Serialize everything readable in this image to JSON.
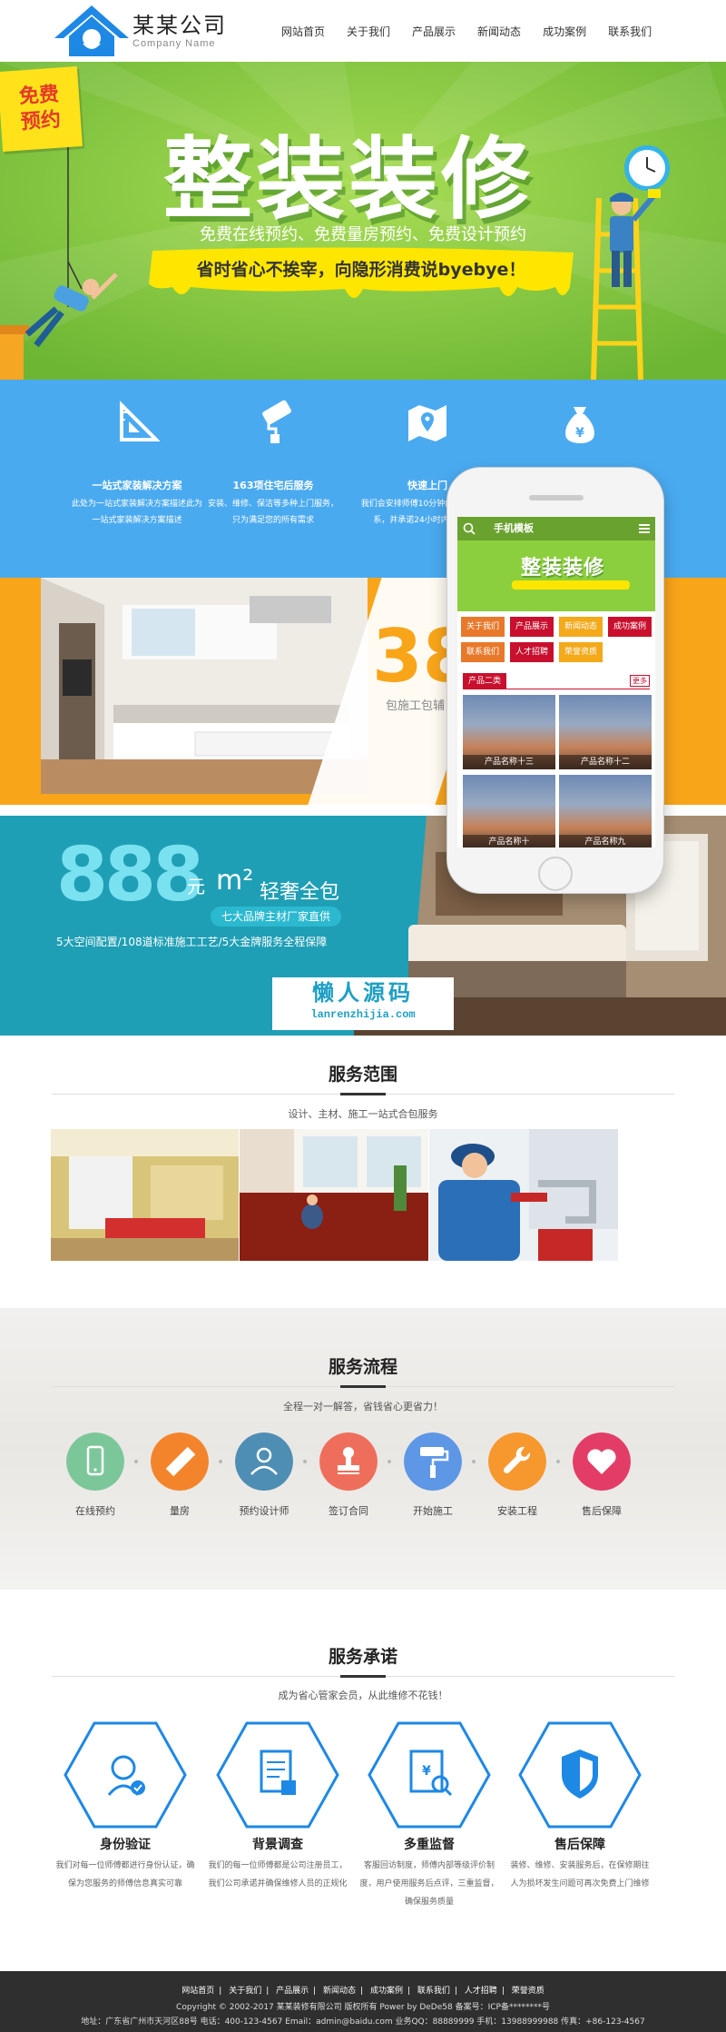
{
  "header": {
    "company_name": "某某公司",
    "company_name_en": "Company Name",
    "nav": [
      "网站首页",
      "关于我们",
      "产品展示",
      "新闻动态",
      "成功案例",
      "联系我们"
    ]
  },
  "hero": {
    "badge_line1": "免费",
    "badge_line2": "预约",
    "title": "整装装修",
    "subtitle": "免费在线预约、免费量房预约、免费设计预约",
    "ribbon": "省时省心不挨宰，向隐形消费说byebye！"
  },
  "features": [
    {
      "icon": "ruler-triangle-icon",
      "title": "一站式家装解决方案",
      "desc": "此处为一站式家装解决方案描述此为一站式家装解决方案描述"
    },
    {
      "icon": "paint-roller-icon",
      "title": "163项住宅后服务",
      "desc": "安装、维修、保洁等多种上门服务，只为满足您的所有需求"
    },
    {
      "icon": "map-pin-icon",
      "title": "快速上门",
      "desc": "我们会安排师傅10分钟内与您取得联系，并承诺24小时内上门服务"
    },
    {
      "icon": "money-bag-icon",
      "title": "",
      "desc": ""
    }
  ],
  "kitchen": {
    "big": "38",
    "sub": "包施工包辅"
  },
  "bedroom": {
    "big": "888",
    "unit": "元",
    "m2": "m²",
    "lux": "轻奢全包",
    "tag": "七大品牌主材厂家直供",
    "desc": "5大空间配置/108道标准施工工艺/5大金牌服务全程保障"
  },
  "watermark": {
    "cn": "懒人源码",
    "en": "lanrenzhijia.com"
  },
  "phone": {
    "header_title": "手机模板",
    "banner_title": "整装装修",
    "buttons": [
      "关于我们",
      "产品展示",
      "新闻动态",
      "成功案例",
      "联系我们",
      "人才招聘",
      "荣誉资质"
    ],
    "section_tab": "产品二类",
    "section_more": "更多",
    "products": [
      "产品名称十三",
      "产品名称十二",
      "产品名称十",
      "产品名称九"
    ]
  },
  "scope": {
    "title": "服务范围",
    "subtitle": "设计、主材、施工一站式合包服务"
  },
  "process": {
    "title": "服务流程",
    "subtitle": "全程一对一解答，省钱省心更省力！",
    "steps": [
      {
        "label": "在线预约",
        "icon": "phone-icon",
        "color": "#7cc79a"
      },
      {
        "label": "量房",
        "icon": "ruler-icon",
        "color": "#f4842b"
      },
      {
        "label": "预约设计师",
        "icon": "designer-icon",
        "color": "#4f8eb4"
      },
      {
        "label": "签订合同",
        "icon": "stamp-icon",
        "color": "#ef6e5b"
      },
      {
        "label": "开始施工",
        "icon": "paint-roller-icon",
        "color": "#5d97e6"
      },
      {
        "label": "安装工程",
        "icon": "wrench-icon",
        "color": "#f7982e"
      },
      {
        "label": "售后保障",
        "icon": "heart-icon",
        "color": "#e33d67"
      }
    ]
  },
  "promise": {
    "title": "服务承诺",
    "subtitle": "成为省心管家会员，从此维修不花钱！",
    "items": [
      {
        "title": "身份验证",
        "icon": "id-check-icon",
        "desc": "我们对每一位师傅都进行身份认证，确保为您服务的师傅信息真实可靠"
      },
      {
        "title": "背景调查",
        "icon": "document-check-icon",
        "desc": "我们的每一位师傅都是公司注册员工，我们公司承诺并确保维修人员的正规化"
      },
      {
        "title": "多重监督",
        "icon": "search-document-icon",
        "desc": "客服回访制度，师傅内部等级评价制度，用户使用服务后点评，三重监督，确保服务质量"
      },
      {
        "title": "售后保障",
        "icon": "shield-icon",
        "desc": "装修、维修、安装服务后，在保修期往人为损坏发生问题可再次免费上门维修"
      }
    ]
  },
  "footer": {
    "nav": [
      "网站首页",
      "关于我们",
      "产品展示",
      "新闻动态",
      "成功案例",
      "联系我们",
      "人才招聘",
      "荣誉资质"
    ],
    "copyright": "Copyright © 2002-2017 某某装修有限公司 版权所有 Power by DeDe58 备案号：ICP备********号",
    "contact": "地址：广东省广州市天河区88号   电话：400-123-4567   Email：admin@baidu.com   业务QQ：88889999   手机：13988999988   传真：+86-123-4567"
  },
  "colors": {
    "hero_green": "#7dc242",
    "feature_blue": "#4aaaf0",
    "kitchen_orange": "#f9a51a",
    "bedroom_teal": "#1f9fb5",
    "promise_blue": "#1e88e5",
    "footer_dark": "#2f2f2f"
  }
}
